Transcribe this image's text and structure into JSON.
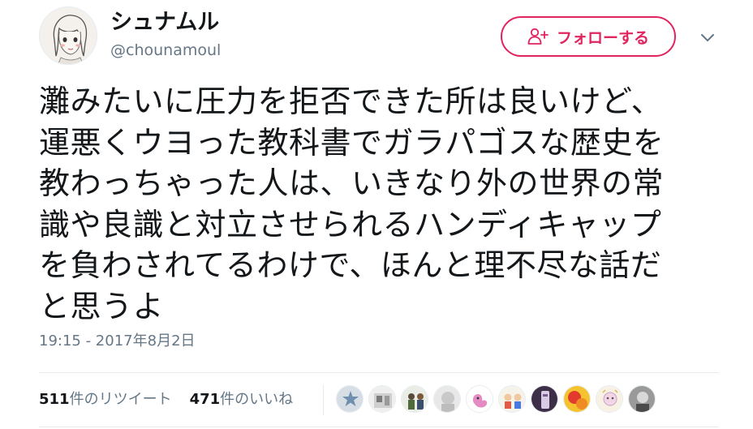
{
  "user": {
    "display_name": "シュナムル",
    "screen_name": "@chounamoul"
  },
  "follow_button": {
    "label": "フォローする",
    "icon": "person-add-icon"
  },
  "menu_icon": "chevron-down-icon",
  "tweet": {
    "text": "灘みたいに圧力を拒否できた所は良いけど、\n運悪くウヨった教科書でガラパゴスな歴史を\n教わっちゃった人は、いきなり外の世界の常\n識や良識と対立させられるハンディキャップ\nを負わされてるわけで、ほんと理不尽な話だ\nと思うよ",
    "timestamp": "19:15 - 2017年8月2日"
  },
  "stats": {
    "retweets": {
      "count": "511",
      "label": "件のリツイート"
    },
    "likes": {
      "count": "471",
      "label": "件のいいね"
    }
  },
  "colors": {
    "accent": "#e0245e",
    "text": "#14171a",
    "secondary": "#657786",
    "divider": "#e6ecf0"
  }
}
